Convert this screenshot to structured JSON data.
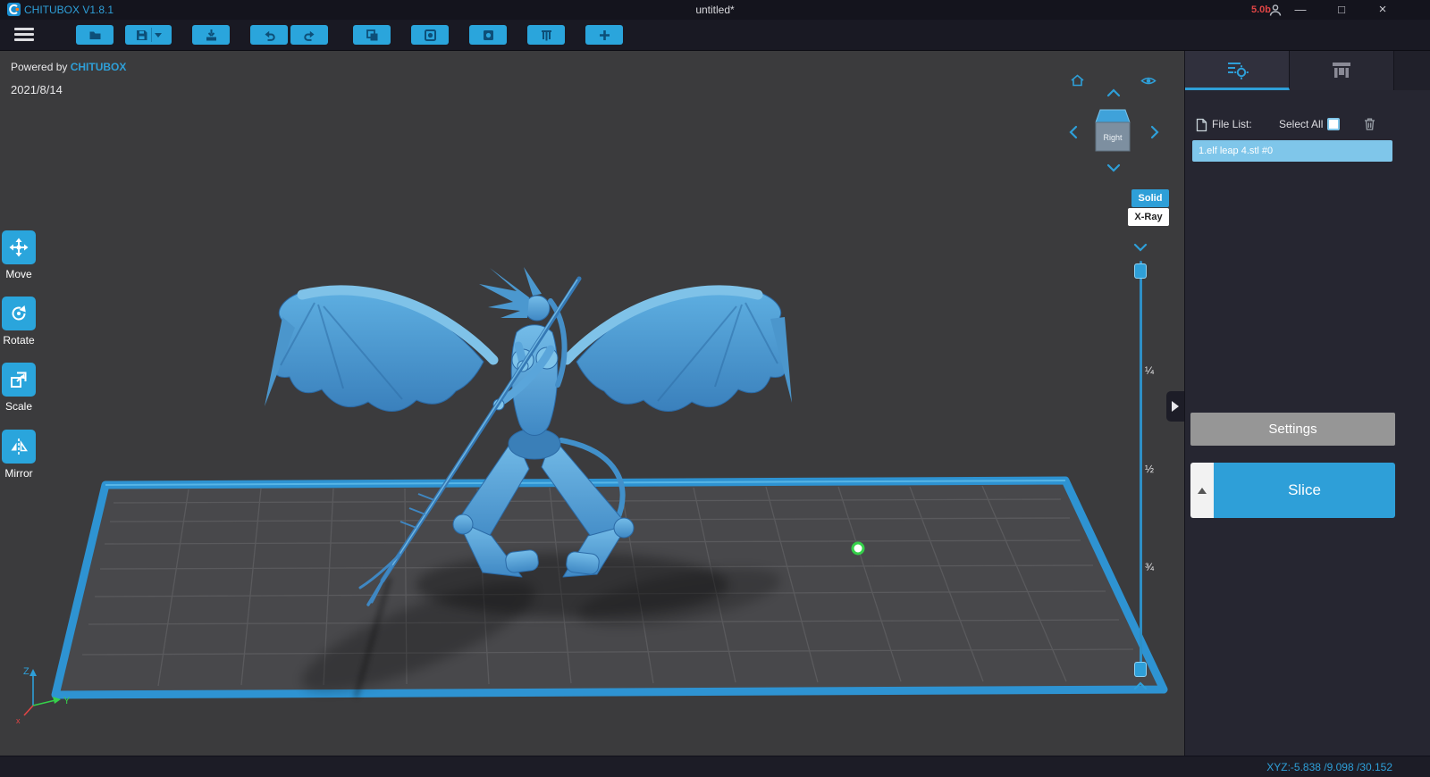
{
  "colors": {
    "accent_blue": "#2e9fd8",
    "toolbar_button_blue": "#2aa5dc",
    "selection_blue": "#7fc6ea",
    "model_blue": "#4f9fd6",
    "marker_green": "#35d04a",
    "version_red": "#e04545",
    "viewport_gray": "#3b3b3d",
    "panel_dark": "#262631"
  },
  "titlebar": {
    "app_title": "CHITUBOX V1.8.1",
    "document_title": "untitled*",
    "version_badge": "5.0b",
    "window_controls": {
      "minimize": "—",
      "maximize": "□",
      "close": "×"
    }
  },
  "toolbar": {
    "button_icons": [
      "open-file-icon",
      "save-file-icon",
      "import-model-icon",
      "undo-icon",
      "redo-icon",
      "clone-icon",
      "hollow-icon",
      "dig-hole-icon",
      "auto-layout-icon",
      "repair-icon"
    ]
  },
  "left_tools": {
    "items": [
      {
        "label": "Move",
        "icon": "move-icon"
      },
      {
        "label": "Rotate",
        "icon": "rotate-icon"
      },
      {
        "label": "Scale",
        "icon": "scale-icon"
      },
      {
        "label": "Mirror",
        "icon": "mirror-icon"
      }
    ]
  },
  "viewport": {
    "watermark_prefix": "Powered by ",
    "watermark_brand": "CHITUBOX",
    "date": "2021/8/14",
    "nav_cube_face": "Right",
    "render_modes": {
      "solid": "Solid",
      "xray": "X-Ray",
      "selected": "Solid"
    },
    "layer_slider_ticks": [
      "¼",
      "½",
      "¾"
    ],
    "axis_labels": {
      "x": "x",
      "y": "Y",
      "z": "Z"
    }
  },
  "right_panel": {
    "file_list_label": "File List:",
    "select_all_label": "Select All",
    "select_all_checked": false,
    "files": [
      {
        "name": "1.elf leap 4.stl #0",
        "selected": true
      }
    ],
    "settings_button": "Settings",
    "slice_button": "Slice"
  },
  "statusbar": {
    "coordinates": "XYZ:-5.838 /9.098 /30.152"
  }
}
